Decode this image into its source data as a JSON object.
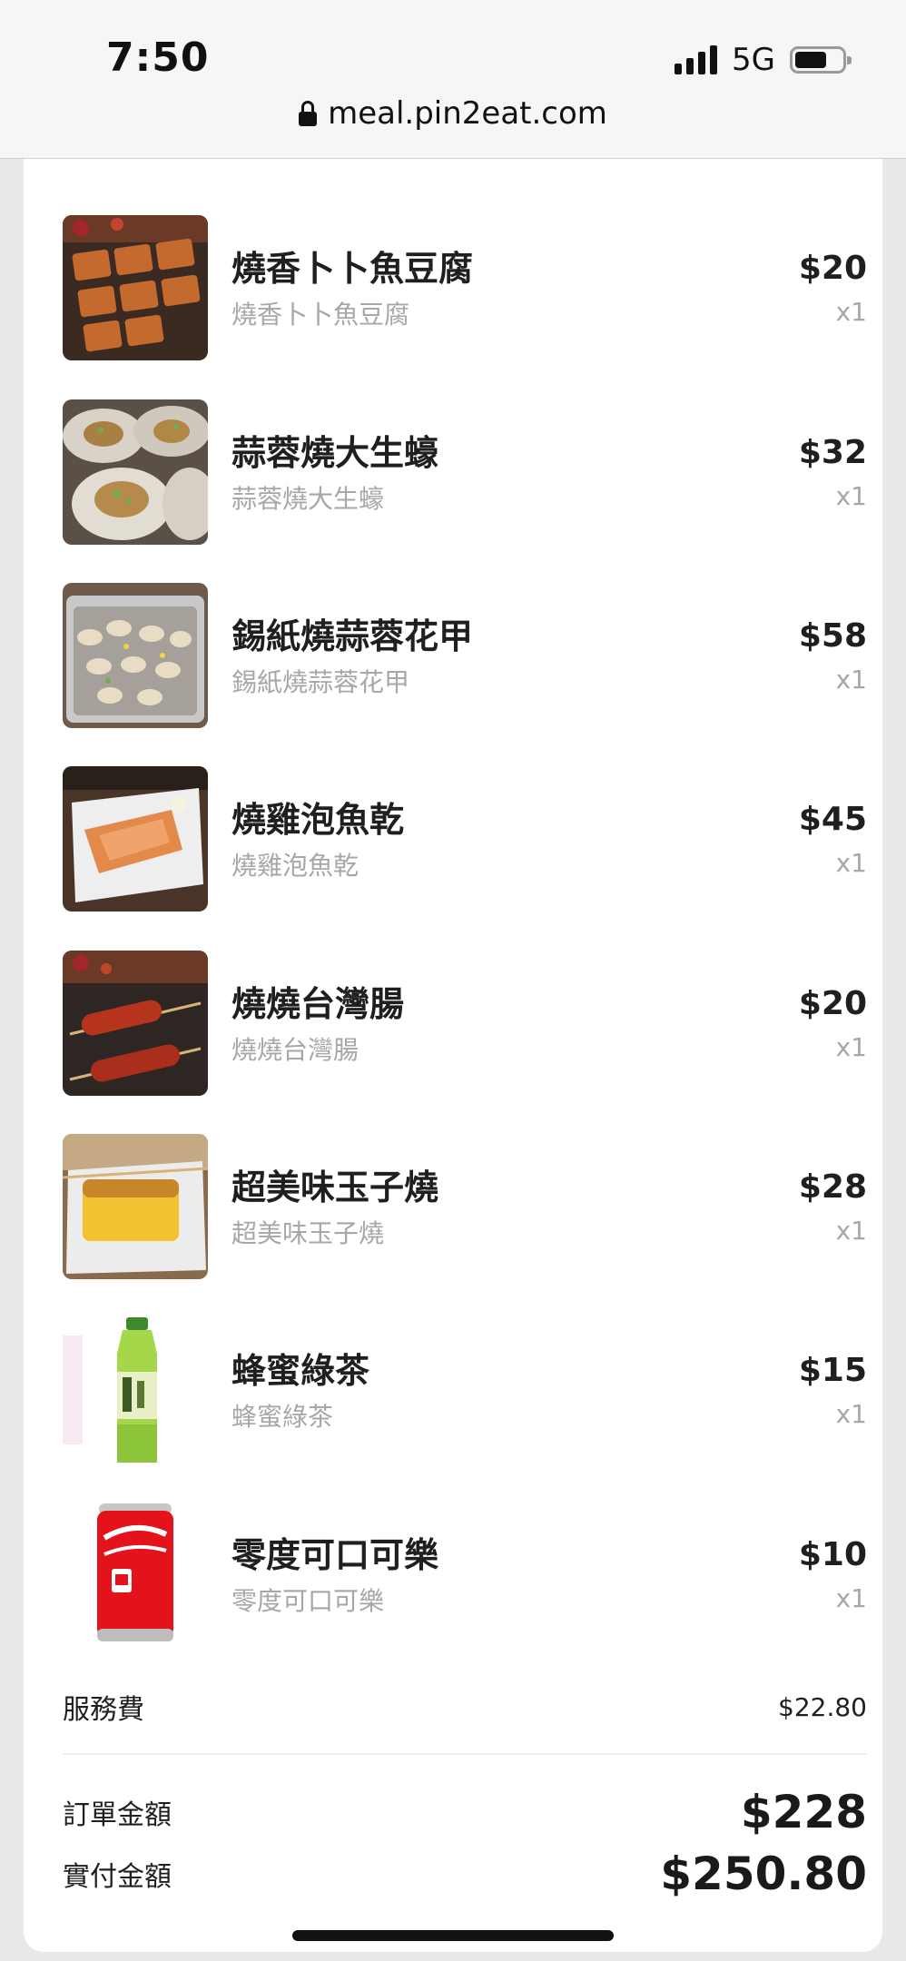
{
  "status_bar": {
    "time": "7:50",
    "network": "5G",
    "battery_level": 0.6
  },
  "browser": {
    "url": "meal.pin2eat.com"
  },
  "items": [
    {
      "title": "燒香卜卜魚豆腐",
      "subtitle": "燒香卜卜魚豆腐",
      "price": "$20",
      "qty": "x1",
      "image_icon": "grilled-fish-tofu-photo"
    },
    {
      "title": "蒜蓉燒大生蠔",
      "subtitle": "蒜蓉燒大生蠔",
      "price": "$32",
      "qty": "x1",
      "image_icon": "garlic-oyster-photo"
    },
    {
      "title": "錫紙燒蒜蓉花甲",
      "subtitle": "錫紙燒蒜蓉花甲",
      "price": "$58",
      "qty": "x1",
      "image_icon": "foil-clams-photo"
    },
    {
      "title": "燒雞泡魚乾",
      "subtitle": "燒雞泡魚乾",
      "price": "$45",
      "qty": "x1",
      "image_icon": "dried-pufferfish-photo"
    },
    {
      "title": "燒燒台灣腸",
      "subtitle": "燒燒台灣腸",
      "price": "$20",
      "qty": "x1",
      "image_icon": "taiwan-sausage-photo"
    },
    {
      "title": "超美味玉子燒",
      "subtitle": "超美味玉子燒",
      "price": "$28",
      "qty": "x1",
      "image_icon": "tamagoyaki-photo"
    },
    {
      "title": "蜂蜜綠茶",
      "subtitle": "蜂蜜綠茶",
      "price": "$15",
      "qty": "x1",
      "image_icon": "green-tea-bottle-photo"
    },
    {
      "title": "零度可口可樂",
      "subtitle": "零度可口可樂",
      "price": "$10",
      "qty": "x1",
      "image_icon": "coke-zero-can-photo"
    }
  ],
  "summary": {
    "service_fee_label": "服務費",
    "service_fee_value": "$22.80",
    "order_amount_label": "訂單金額",
    "order_amount_value": "$228",
    "paid_amount_label": "實付金額",
    "paid_amount_value": "$250.80"
  },
  "colors": {
    "text_primary": "#1f1f1f",
    "text_secondary": "#a7a7a7",
    "page_background": "#e9e9e9",
    "card_background": "#ffffff"
  }
}
